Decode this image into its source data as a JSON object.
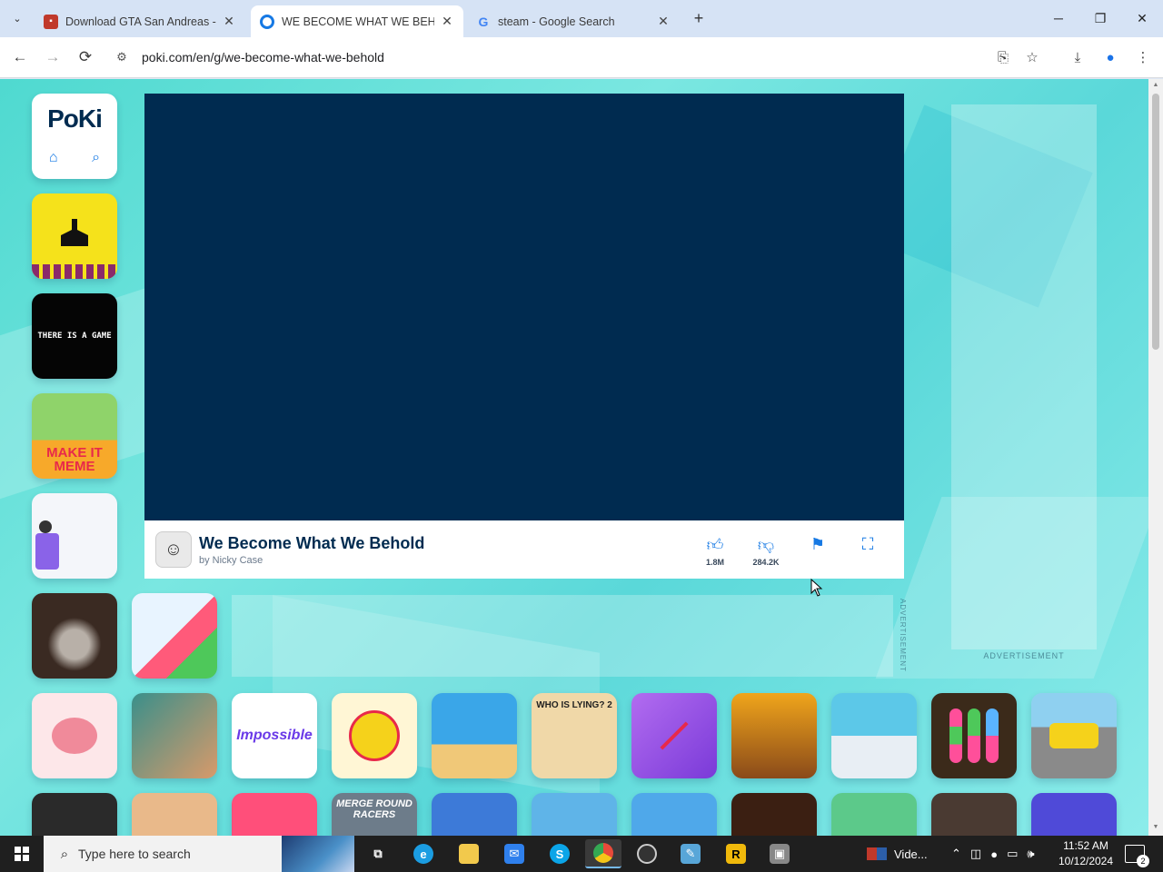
{
  "browser": {
    "tabs": [
      {
        "title": "Download GTA San Andreas - G",
        "favicon_color": "#c0392b",
        "active": false
      },
      {
        "title": "WE BECOME WHAT WE BEHOLD",
        "favicon_color": "#1679e4",
        "active": true
      },
      {
        "title": "steam - Google Search",
        "favicon_color": "#4285f4",
        "active": false
      }
    ],
    "url": "poki.com/en/g/we-become-what-we-behold",
    "new_tab": "+",
    "nav": {
      "back": "←",
      "forward": "→",
      "reload": "⟳"
    },
    "window": {
      "minimize": "─",
      "restore": "❐",
      "close": "✕"
    }
  },
  "site": {
    "logo": "PoKi",
    "home_icon": "home-icon",
    "search_icon": "search-icon",
    "left_tiles": [
      {
        "label": "",
        "bg": "#f5e21b",
        "name": "game-tile-yellow-runner"
      },
      {
        "label": "THERE IS A GAME",
        "bg": "#050505",
        "name": "game-tile-there-is-a-game"
      },
      {
        "label": "MAKE IT MEME",
        "bg": "#f7a92a",
        "name": "game-tile-make-it-meme"
      },
      {
        "label": "",
        "bg": "#f4f6fa",
        "name": "game-tile-white"
      },
      {
        "label": "",
        "bg": "#3a2a22",
        "name": "game-tile-knight"
      }
    ],
    "tile_watermelon": {
      "label": "",
      "bg": "#e8f4ff"
    },
    "game": {
      "title": "We Become What We Behold",
      "author": "by Nicky Case",
      "likes": "1.8M",
      "dislikes": "284.2K"
    },
    "ad_label_vertical": "ADVERTISEMENT",
    "ad_label_side": "ADVERTISEMENT",
    "bottom_row_1": [
      {
        "label": "",
        "bg": "#fde7e9",
        "name": "game-tile-brain-test"
      },
      {
        "label": "",
        "bg": "#3a8f8a",
        "name": "game-tile-face-puzzle"
      },
      {
        "label": "Impossible",
        "bg": "#ffffff",
        "name": "game-tile-impossible"
      },
      {
        "label": "",
        "bg": "#fff6d5",
        "name": "game-tile-angry-ball"
      },
      {
        "label": "",
        "bg": "#3aa6e8",
        "name": "game-tile-moto-x3m"
      },
      {
        "label": "WHO IS LYING? 2",
        "bg": "#f0d8a8",
        "name": "game-tile-who-is-lying"
      },
      {
        "label": "",
        "bg": "#a25ce8",
        "name": "game-tile-stickman-hook"
      },
      {
        "label": "",
        "bg": "#f0a51b",
        "name": "game-tile-stick-war"
      },
      {
        "label": "",
        "bg": "#5cc8e8",
        "name": "game-tile-smash-computer"
      },
      {
        "label": "",
        "bg": "#3b2a1a",
        "name": "game-tile-ball-sort"
      },
      {
        "label": "",
        "bg": "#8fd0f0",
        "name": "game-tile-car-racing"
      }
    ],
    "bottom_row_2": [
      {
        "label": "",
        "bg": "#2a2a2a"
      },
      {
        "label": "",
        "bg": "#e9b98a"
      },
      {
        "label": "",
        "bg": "#ff4f7a"
      },
      {
        "label": "MERGE ROUND RACERS",
        "bg": "#6d7c8a"
      },
      {
        "label": "",
        "bg": "#3d7ad8"
      },
      {
        "label": "",
        "bg": "#5fb4e8"
      },
      {
        "label": "",
        "bg": "#4fa8ea"
      },
      {
        "label": "",
        "bg": "#3b1f12"
      },
      {
        "label": "",
        "bg": "#5cc98a"
      },
      {
        "label": "",
        "bg": "#4a3a32"
      },
      {
        "label": "",
        "bg": "#4f4ad8"
      }
    ]
  },
  "taskbar": {
    "search_placeholder": "Type here to search",
    "video_label": "Vide...",
    "time": "11:52 AM",
    "date": "10/12/2024",
    "notification_count": "2",
    "apps": [
      {
        "name": "task-view",
        "glyph": "⧉",
        "color": "#1f1f1f"
      },
      {
        "name": "edge",
        "glyph": "e",
        "color": "#1b9de2"
      },
      {
        "name": "file-explorer",
        "glyph": "▭",
        "color": "#f2c94c"
      },
      {
        "name": "mail",
        "glyph": "✉",
        "color": "#2f80ed"
      },
      {
        "name": "skype",
        "glyph": "S",
        "color": "#0ba5e8"
      },
      {
        "name": "chrome",
        "glyph": "◉",
        "color": "#e84a3a"
      },
      {
        "name": "obs",
        "glyph": "◎",
        "color": "#333"
      },
      {
        "name": "notepad",
        "glyph": "✎",
        "color": "#58a6d8"
      },
      {
        "name": "rockstar",
        "glyph": "R",
        "color": "#f0b90b"
      },
      {
        "name": "app-window",
        "glyph": "▣",
        "color": "#888"
      }
    ]
  }
}
